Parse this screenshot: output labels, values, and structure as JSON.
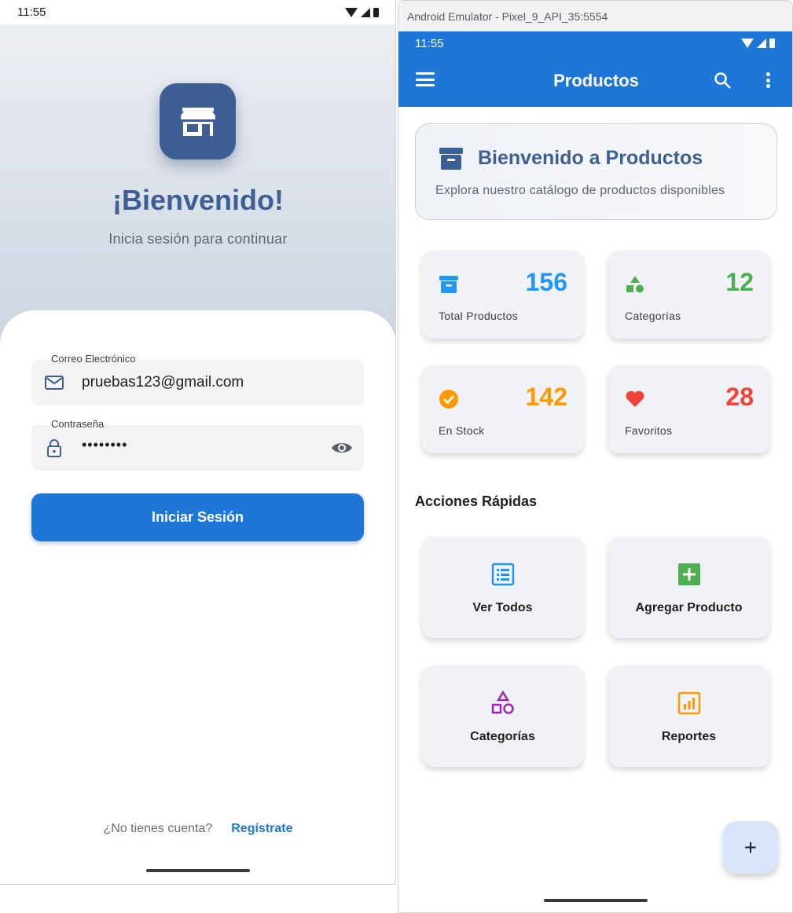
{
  "login": {
    "status_time": "11:55",
    "title": "¡Bienvenido!",
    "subtitle": "Inicia sesión para continuar",
    "email": {
      "label": "Correo Electrónico",
      "value": "pruebas123@gmail.com",
      "icon": "mail-icon"
    },
    "password": {
      "label": "Contraseña",
      "value": "••••••••",
      "icon": "lock-icon",
      "toggle_icon": "eye-icon"
    },
    "submit_label": "Iniciar Sesión",
    "register_question": "¿No tienes cuenta?",
    "register_link": "Regístrate",
    "brand_color": "#3e5f93",
    "accent_color": "#1e76d6"
  },
  "emulator": {
    "window_title": "Android Emulator - Pixel_9_API_35:5554",
    "status_time": "11:55",
    "appbar_title": "Productos",
    "appbar_color": "#1e76d6",
    "welcome_card": {
      "title": "Bienvenido a Productos",
      "subtitle": "Explora nuestro catálogo de productos disponibles"
    },
    "stats": [
      {
        "value": "156",
        "label": "Total Productos",
        "icon": "archive-icon",
        "color": "#2196f3"
      },
      {
        "value": "12",
        "label": "Categorías",
        "icon": "category-icon",
        "color": "#4caf50"
      },
      {
        "value": "142",
        "label": "En Stock",
        "icon": "check-circle-icon",
        "color": "#ff9800"
      },
      {
        "value": "28",
        "label": "Favoritos",
        "icon": "heart-icon",
        "color": "#f44336"
      }
    ],
    "quick_actions_title": "Acciones Rápidas",
    "actions": [
      {
        "label": "Ver Todos",
        "icon": "list-icon",
        "color": "#2196f3"
      },
      {
        "label": "Agregar Producto",
        "icon": "add-box-icon",
        "color": "#4caf50"
      },
      {
        "label": "Categorías",
        "icon": "category-outline-icon",
        "color": "#9c27b0"
      },
      {
        "label": "Reportes",
        "icon": "chart-icon",
        "color": "#ff9800"
      }
    ],
    "fab_label": "+"
  }
}
